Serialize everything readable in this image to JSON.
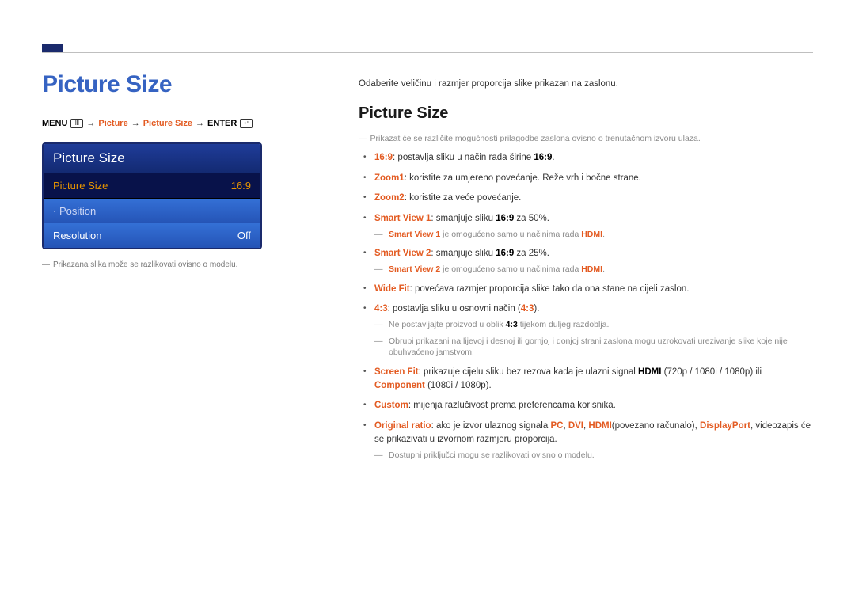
{
  "header": {
    "main_title": "Picture Size"
  },
  "breadcrumb": {
    "menu_label": "MENU",
    "menu_icon": "Ⅲ",
    "arrow": "→",
    "p1": "Picture",
    "p2": "Picture Size",
    "enter_label": "ENTER",
    "enter_icon": "↵"
  },
  "osd": {
    "title": "Picture Size",
    "rows": [
      {
        "label": "Picture Size",
        "value": "16:9",
        "selected": true
      },
      {
        "label": "· Position",
        "value": "",
        "selected": false,
        "disabled": true
      },
      {
        "label": "Resolution",
        "value": "Off",
        "selected": false
      }
    ]
  },
  "left_footnote": "Prikazana slika može se razlikovati ovisno o modelu.",
  "right": {
    "intro": "Odaberite veličinu i razmjer proporcija slike prikazan na zaslonu.",
    "sub_title": "Picture Size",
    "lead_note": "Prikazat će se različite mogućnosti prilagodbe zaslona ovisno o trenutačnom izvoru ulaza.",
    "opt1": {
      "k": "16:9",
      "t": ": postavlja sliku u način rada širine ",
      "k2": "16:9",
      "t2": "."
    },
    "opt2": {
      "k": "Zoom1",
      "t": ": koristite za umjereno povećanje. Reže vrh i bočne strane."
    },
    "opt3": {
      "k": "Zoom2",
      "t": ": koristite za veće povećanje."
    },
    "opt4": {
      "k": "Smart View 1",
      "t": ": smanjuje sliku ",
      "k2": "16:9",
      "t2": " za 50%."
    },
    "opt4_note_a": "Smart View 1",
    "opt4_note_b": " je omogućeno samo u načinima rada ",
    "opt4_note_c": "HDMI",
    "opt4_note_d": ".",
    "opt5": {
      "k": "Smart View 2",
      "t": ": smanjuje sliku ",
      "k2": "16:9",
      "t2": " za 25%."
    },
    "opt5_note_a": "Smart View 2",
    "opt5_note_b": "  je omogućeno samo u načinima rada ",
    "opt5_note_c": "HDMI",
    "opt5_note_d": ".",
    "opt6": {
      "k": "Wide Fit",
      "t": ": povećava razmjer proporcija slike tako da ona stane na cijeli zaslon."
    },
    "opt7": {
      "k": "4:3",
      "t": ": postavlja sliku u osnovni način (",
      "k2": "4:3",
      "t2": ")."
    },
    "opt7_note1_a": "Ne postavljajte proizvod u oblik ",
    "opt7_note1_b": "4:3",
    "opt7_note1_c": " tijekom duljeg razdoblja.",
    "opt7_note2": "Obrubi prikazani na lijevoj i desnoj ili gornjoj i donjoj strani zaslona mogu uzrokovati urezivanje slike koje nije obuhvaćeno jamstvom.",
    "opt8_a": "Screen Fit",
    "opt8_b": ": prikazuje cijelu sliku bez rezova kada je ulazni signal ",
    "opt8_c": "HDMI",
    "opt8_d": " (720p / 1080i / 1080p) ili ",
    "opt8_e": "Component",
    "opt8_f": " (1080i / 1080p).",
    "opt9": {
      "k": "Custom",
      "t": ": mijenja razlučivost prema preferencama korisnika."
    },
    "opt10_a": "Original ratio",
    "opt10_b": ": ako je izvor ulaznog signala ",
    "opt10_c": "PC",
    "opt10_d": ", ",
    "opt10_e": "DVI",
    "opt10_f": ", ",
    "opt10_g": "HDMI",
    "opt10_h": "(povezano računalo), ",
    "opt10_i": "DisplayPort",
    "opt10_j": ", videozapis će se prikazivati u izvornom razmjeru proporcija.",
    "opt10_note": "Dostupni priključci mogu se razlikovati ovisno o modelu."
  }
}
